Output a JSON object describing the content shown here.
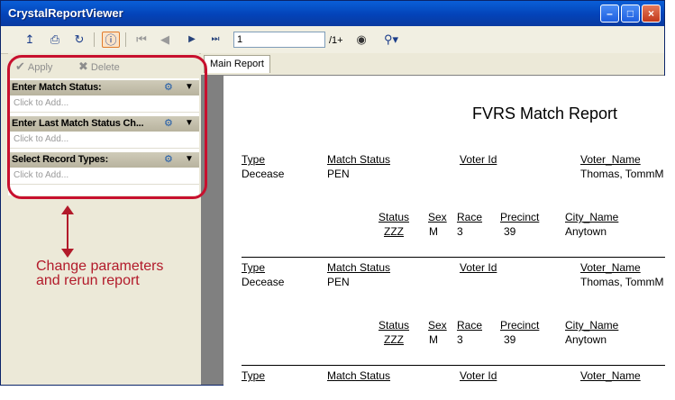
{
  "window": {
    "title": "CrystalReportViewer"
  },
  "toolbar": {
    "page_input": "1",
    "page_count": "/1+"
  },
  "params": {
    "apply_label": "Apply",
    "delete_label": "Delete",
    "items": [
      {
        "label": "Enter Match Status:",
        "placeholder": "Click to Add..."
      },
      {
        "label": "Enter Last Match Status Ch...",
        "placeholder": "Click to Add..."
      },
      {
        "label": "Select Record Types:",
        "placeholder": "Click to Add..."
      }
    ]
  },
  "callout": {
    "text": "Change parameters and rerun report"
  },
  "tabs": {
    "main": "Main Report"
  },
  "report": {
    "title": "FVRS Match Report",
    "headers1": [
      "Type",
      "Match Status",
      "Voter Id",
      "Voter_Name"
    ],
    "headers2": [
      "Status",
      "Sex",
      "Race",
      "Precinct",
      "City_Name"
    ],
    "records": [
      {
        "type": "Decease",
        "match_status": "PEN",
        "voter_name": "Thomas, TommM",
        "status": "ZZZ",
        "sex": "M",
        "race": "3",
        "precinct": "39",
        "city": "Anytown"
      },
      {
        "type": "Decease",
        "match_status": "PEN",
        "voter_name": "Thomas, TommM",
        "status": "ZZZ",
        "sex": "M",
        "race": "3",
        "precinct": "39",
        "city": "Anytown"
      }
    ]
  }
}
